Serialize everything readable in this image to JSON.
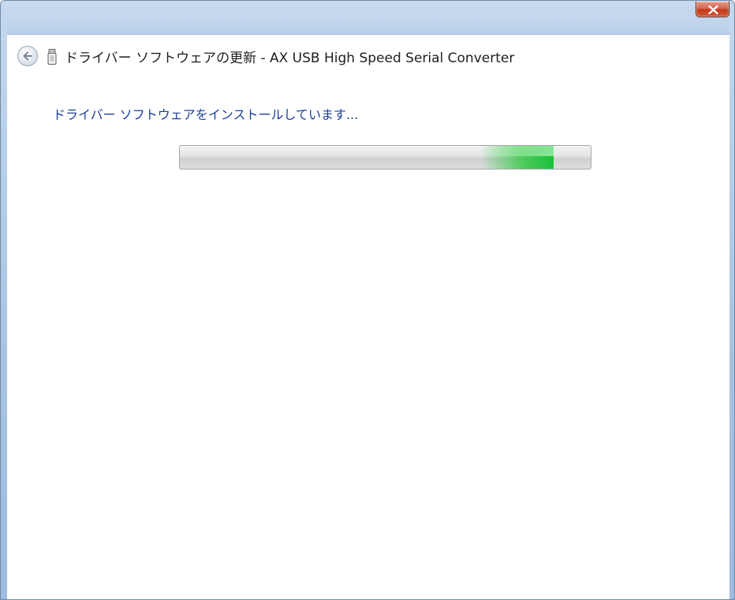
{
  "window": {
    "title": "ドライバー ソフトウェアの更新 - AX USB High Speed Serial Converter",
    "close_label": "Close",
    "accent_color": "#1c3f9a",
    "progress_color": "#19c138"
  },
  "header": {
    "back_icon": "back-arrow-icon",
    "device_icon": "usb-device-icon"
  },
  "main": {
    "status_text": "ドライバー ソフトウェアをインストールしています...",
    "progress": {
      "style": "marquee-indeterminate",
      "position_fraction": 0.82
    }
  }
}
